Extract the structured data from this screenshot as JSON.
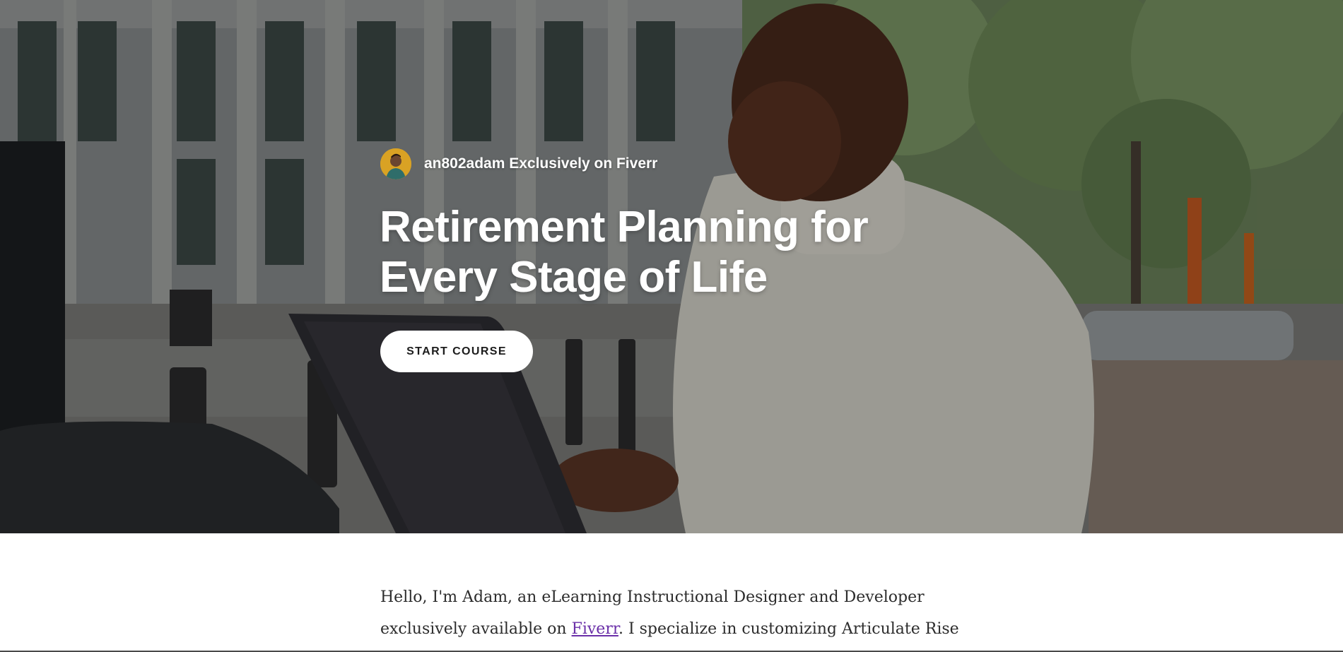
{
  "hero": {
    "author": {
      "name": "an802adam Exclusively on Fiverr",
      "avatar_icon": "author-avatar"
    },
    "title_lines": [
      "Retirement Planning for",
      "Every Stage of Life"
    ],
    "start_button_label": "START COURSE"
  },
  "intro": {
    "part1": "Hello, I'm Adam, an eLearning Instructional Designer and Developer exclusively available on ",
    "link_text": "Fiverr",
    "part2": ". I specialize in customizing Articulate Rise"
  },
  "colors": {
    "button_bg": "#ffffff",
    "title_text": "#ffffff",
    "link": "#6a2fa8",
    "body_text": "#2c2c2c"
  }
}
